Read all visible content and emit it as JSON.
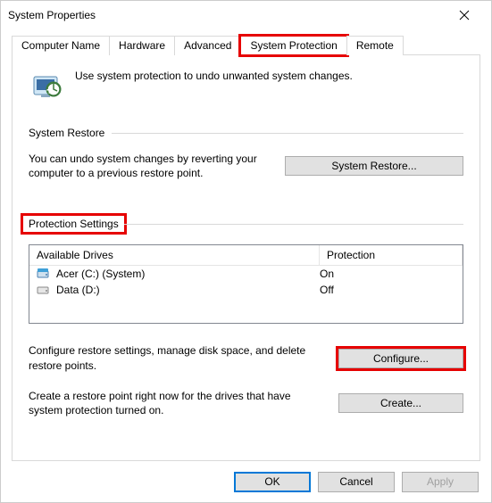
{
  "window": {
    "title": "System Properties"
  },
  "tabs": {
    "computer_name": "Computer Name",
    "hardware": "Hardware",
    "advanced": "Advanced",
    "system_protection": "System Protection",
    "remote": "Remote"
  },
  "intro": "Use system protection to undo unwanted system changes.",
  "sections": {
    "restore": {
      "title": "System Restore",
      "desc": "You can undo system changes by reverting your computer to a previous restore point.",
      "button": "System Restore..."
    },
    "protection": {
      "title": "Protection Settings",
      "columns": {
        "drives": "Available Drives",
        "protection": "Protection"
      },
      "drives": [
        {
          "name": "Acer (C:) (System)",
          "status": "On"
        },
        {
          "name": "Data (D:)",
          "status": "Off"
        }
      ],
      "configure": {
        "desc": "Configure restore settings, manage disk space, and delete restore points.",
        "button": "Configure..."
      },
      "create": {
        "desc": "Create a restore point right now for the drives that have system protection turned on.",
        "button": "Create..."
      }
    }
  },
  "footer": {
    "ok": "OK",
    "cancel": "Cancel",
    "apply": "Apply"
  }
}
